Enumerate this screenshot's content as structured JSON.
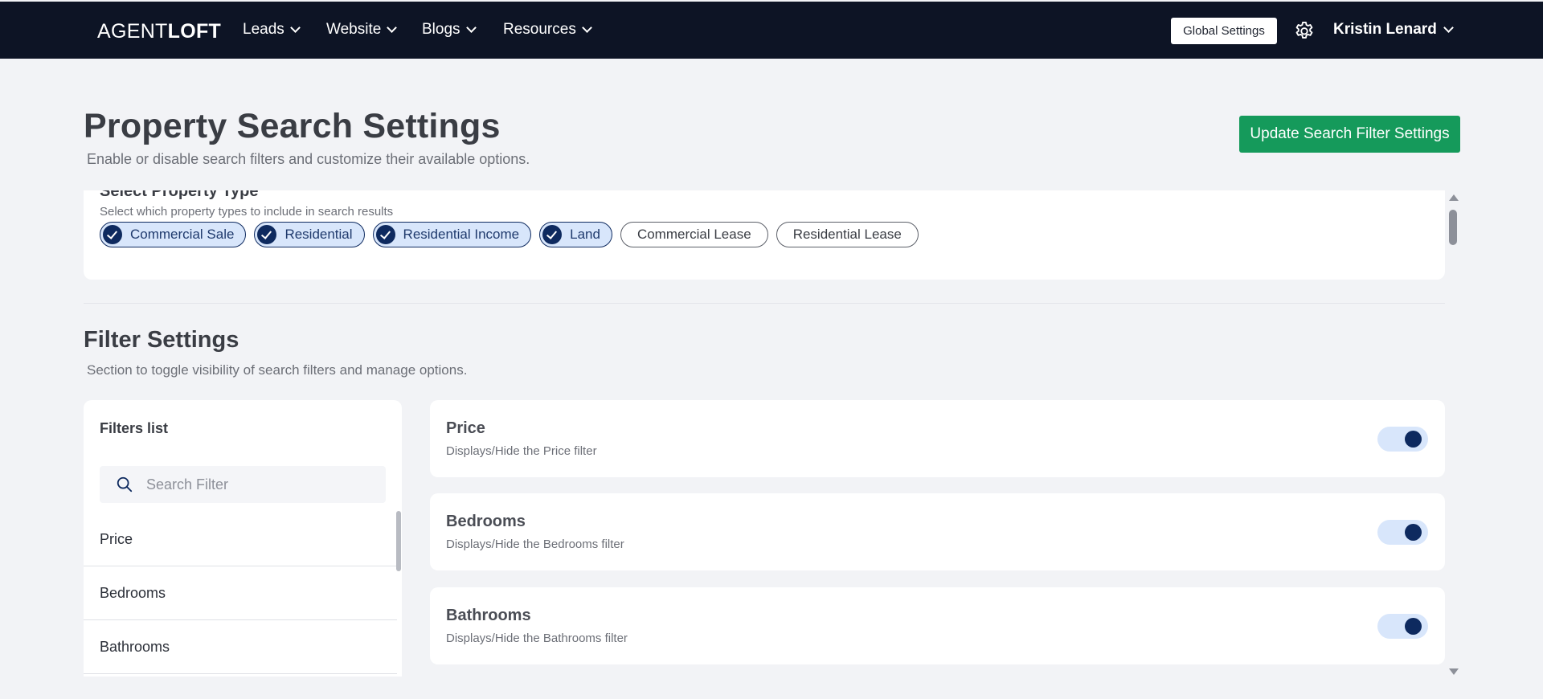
{
  "nav": {
    "logo_light": "AGENT",
    "logo_bold": "LOFT",
    "items": [
      {
        "label": "Leads"
      },
      {
        "label": "Website"
      },
      {
        "label": "Blogs"
      },
      {
        "label": "Resources"
      }
    ],
    "global_settings_label": "Global Settings",
    "settings_icon": "gear-icon",
    "user_name": "Kristin Lenard"
  },
  "header": {
    "title": "Property Search Settings",
    "subtitle": "Enable or disable search filters and customize their available options.",
    "update_button_label": "Update Search Filter Settings"
  },
  "property_type": {
    "title": "Select Property Type",
    "subtitle": "Select which property types to include in search results",
    "options": [
      {
        "label": "Commercial Sale",
        "selected": true
      },
      {
        "label": "Residential",
        "selected": true
      },
      {
        "label": "Residential Income",
        "selected": true
      },
      {
        "label": "Land",
        "selected": true
      },
      {
        "label": "Commercial Lease",
        "selected": false
      },
      {
        "label": "Residential Lease",
        "selected": false
      }
    ]
  },
  "filter_settings": {
    "title": "Filter Settings",
    "subtitle": "Section to toggle visibility of search filters and manage options.",
    "list_title": "Filters list",
    "search_placeholder": "Search Filter",
    "list_items": [
      "Price",
      "Bedrooms",
      "Bathrooms"
    ],
    "filters": [
      {
        "title": "Price",
        "description": "Displays/Hide the Price filter",
        "enabled": true
      },
      {
        "title": "Bedrooms",
        "description": "Displays/Hide the Bedrooms filter",
        "enabled": true
      },
      {
        "title": "Bathrooms",
        "description": "Displays/Hide the Bathrooms filter",
        "enabled": true
      }
    ]
  },
  "colors": {
    "nav_bg": "#0d1425",
    "primary_button": "#159a5b",
    "chip_selected_bg": "#d8e6fb",
    "accent_navy": "#0e2a5f"
  }
}
